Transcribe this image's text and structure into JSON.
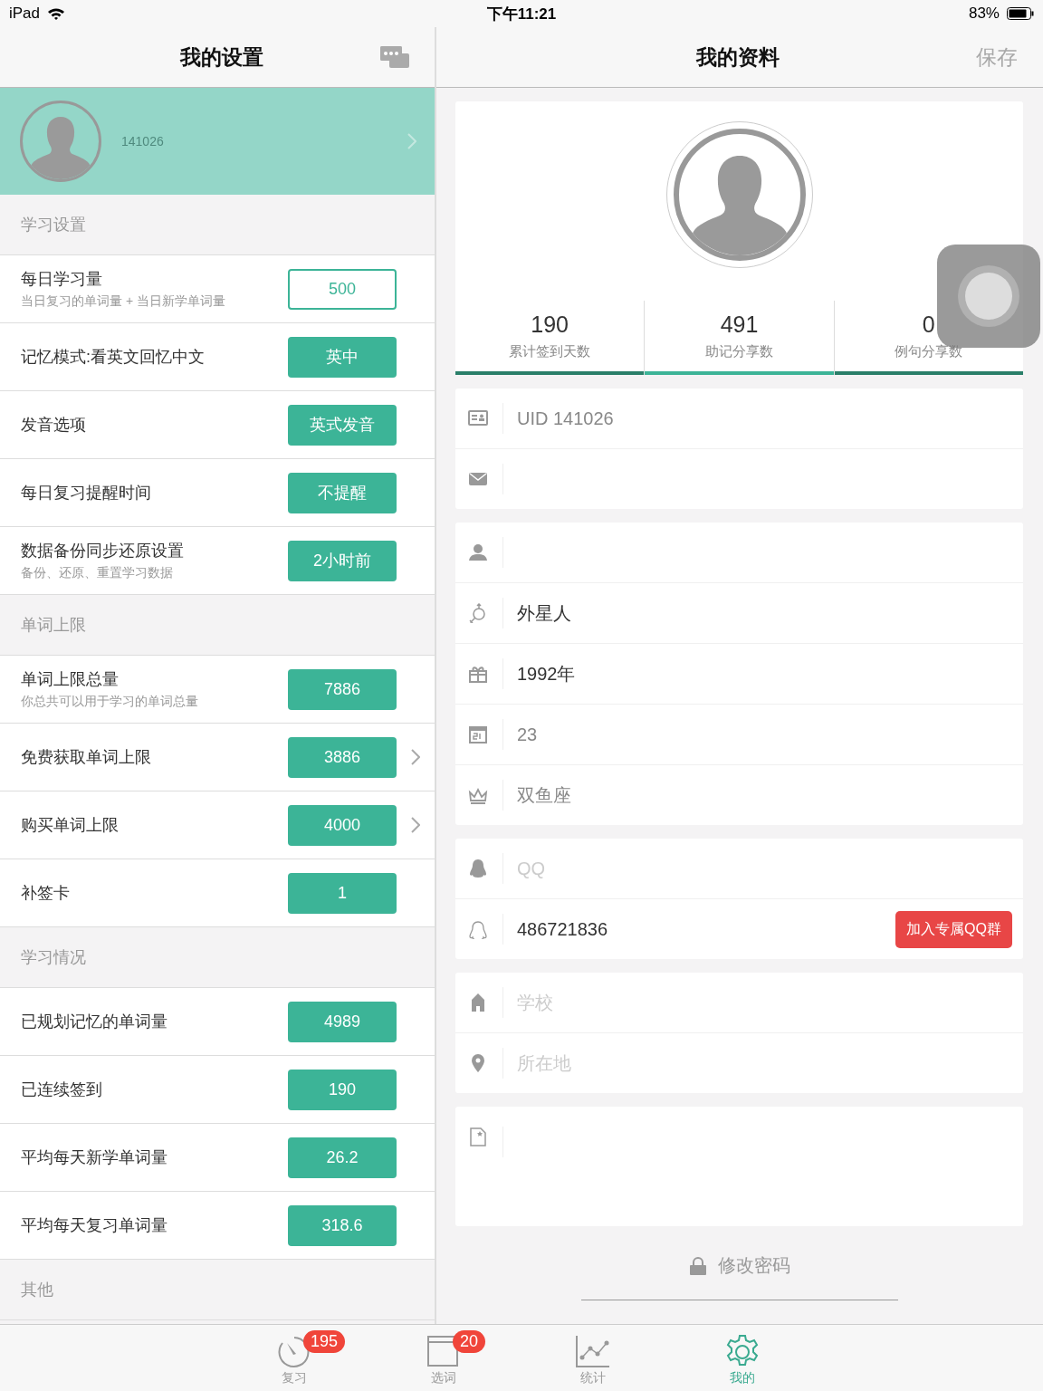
{
  "status_bar": {
    "device": "iPad",
    "time": "下午11:21",
    "battery": "83%"
  },
  "left": {
    "title": "我的设置",
    "profile": {
      "uid": "141026"
    },
    "sections": [
      {
        "title": "学习设置",
        "rows": [
          {
            "label": "每日学习量",
            "sub": "当日复习的单词量 + 当日新学单词量",
            "value": "500",
            "kind": "outline",
            "has_arrow": false
          },
          {
            "label": "记忆模式:看英文回忆中文",
            "value": "英中",
            "kind": "filled",
            "has_arrow": false
          },
          {
            "label": "发音选项",
            "value": "英式发音",
            "kind": "filled",
            "has_arrow": false
          },
          {
            "label": "每日复习提醒时间",
            "value": "不提醒",
            "kind": "filled",
            "has_arrow": false
          },
          {
            "label": "数据备份同步还原设置",
            "sub": "备份、还原、重置学习数据",
            "value": "2小时前",
            "kind": "filled",
            "has_arrow": false
          }
        ]
      },
      {
        "title": "单词上限",
        "rows": [
          {
            "label": "单词上限总量",
            "sub": "你总共可以用于学习的单词总量",
            "value": "7886",
            "kind": "filled",
            "has_arrow": false
          },
          {
            "label": "免费获取单词上限",
            "value": "3886",
            "kind": "filled",
            "has_arrow": true
          },
          {
            "label": "购买单词上限",
            "value": "4000",
            "kind": "filled",
            "has_arrow": true
          },
          {
            "label": "补签卡",
            "value": "1",
            "kind": "filled",
            "has_arrow": false
          }
        ]
      },
      {
        "title": "学习情况",
        "rows": [
          {
            "label": "已规划记忆的单词量",
            "value": "4989",
            "kind": "filled",
            "has_arrow": false
          },
          {
            "label": "已连续签到",
            "value": "190",
            "kind": "filled",
            "has_arrow": false
          },
          {
            "label": "平均每天新学单词量",
            "value": "26.2",
            "kind": "filled",
            "has_arrow": false
          },
          {
            "label": "平均每天复习单词量",
            "value": "318.6",
            "kind": "filled",
            "has_arrow": false
          }
        ]
      },
      {
        "title": "其他"
      }
    ]
  },
  "right": {
    "title": "我的资料",
    "save": {
      "label": "保存",
      "disabled": true
    },
    "stats": [
      {
        "value": "190",
        "label": "累计签到天数",
        "selected": false
      },
      {
        "value": "491",
        "label": "助记分享数",
        "selected": true
      },
      {
        "value": "0",
        "label": "例句分享数",
        "selected": false
      }
    ],
    "groups": [
      [
        {
          "kind": "readonly",
          "text": "UID 141026"
        },
        {
          "kind": "value"
        }
      ],
      [
        {
          "kind": "value"
        },
        {
          "kind": "value",
          "text": "外星人"
        },
        {
          "kind": "value",
          "text": "1992年"
        },
        {
          "kind": "readonly",
          "text": "23"
        },
        {
          "kind": "readonly",
          "text": "双鱼座"
        }
      ],
      [
        {
          "kind": "placeholder",
          "text": "QQ"
        },
        {
          "kind": "value",
          "text": "486721836",
          "button": "加入专属QQ群"
        }
      ],
      [
        {
          "kind": "placeholder",
          "text": "学校"
        },
        {
          "kind": "placeholder",
          "text": "所在地"
        }
      ]
    ],
    "change_password": "修改密码"
  },
  "tab_bar": [
    {
      "label": "复习",
      "badge": "195",
      "selected": false
    },
    {
      "label": "选词",
      "badge": "20",
      "selected": false
    },
    {
      "label": "统计",
      "selected": false
    },
    {
      "label": "我的",
      "selected": true
    }
  ]
}
